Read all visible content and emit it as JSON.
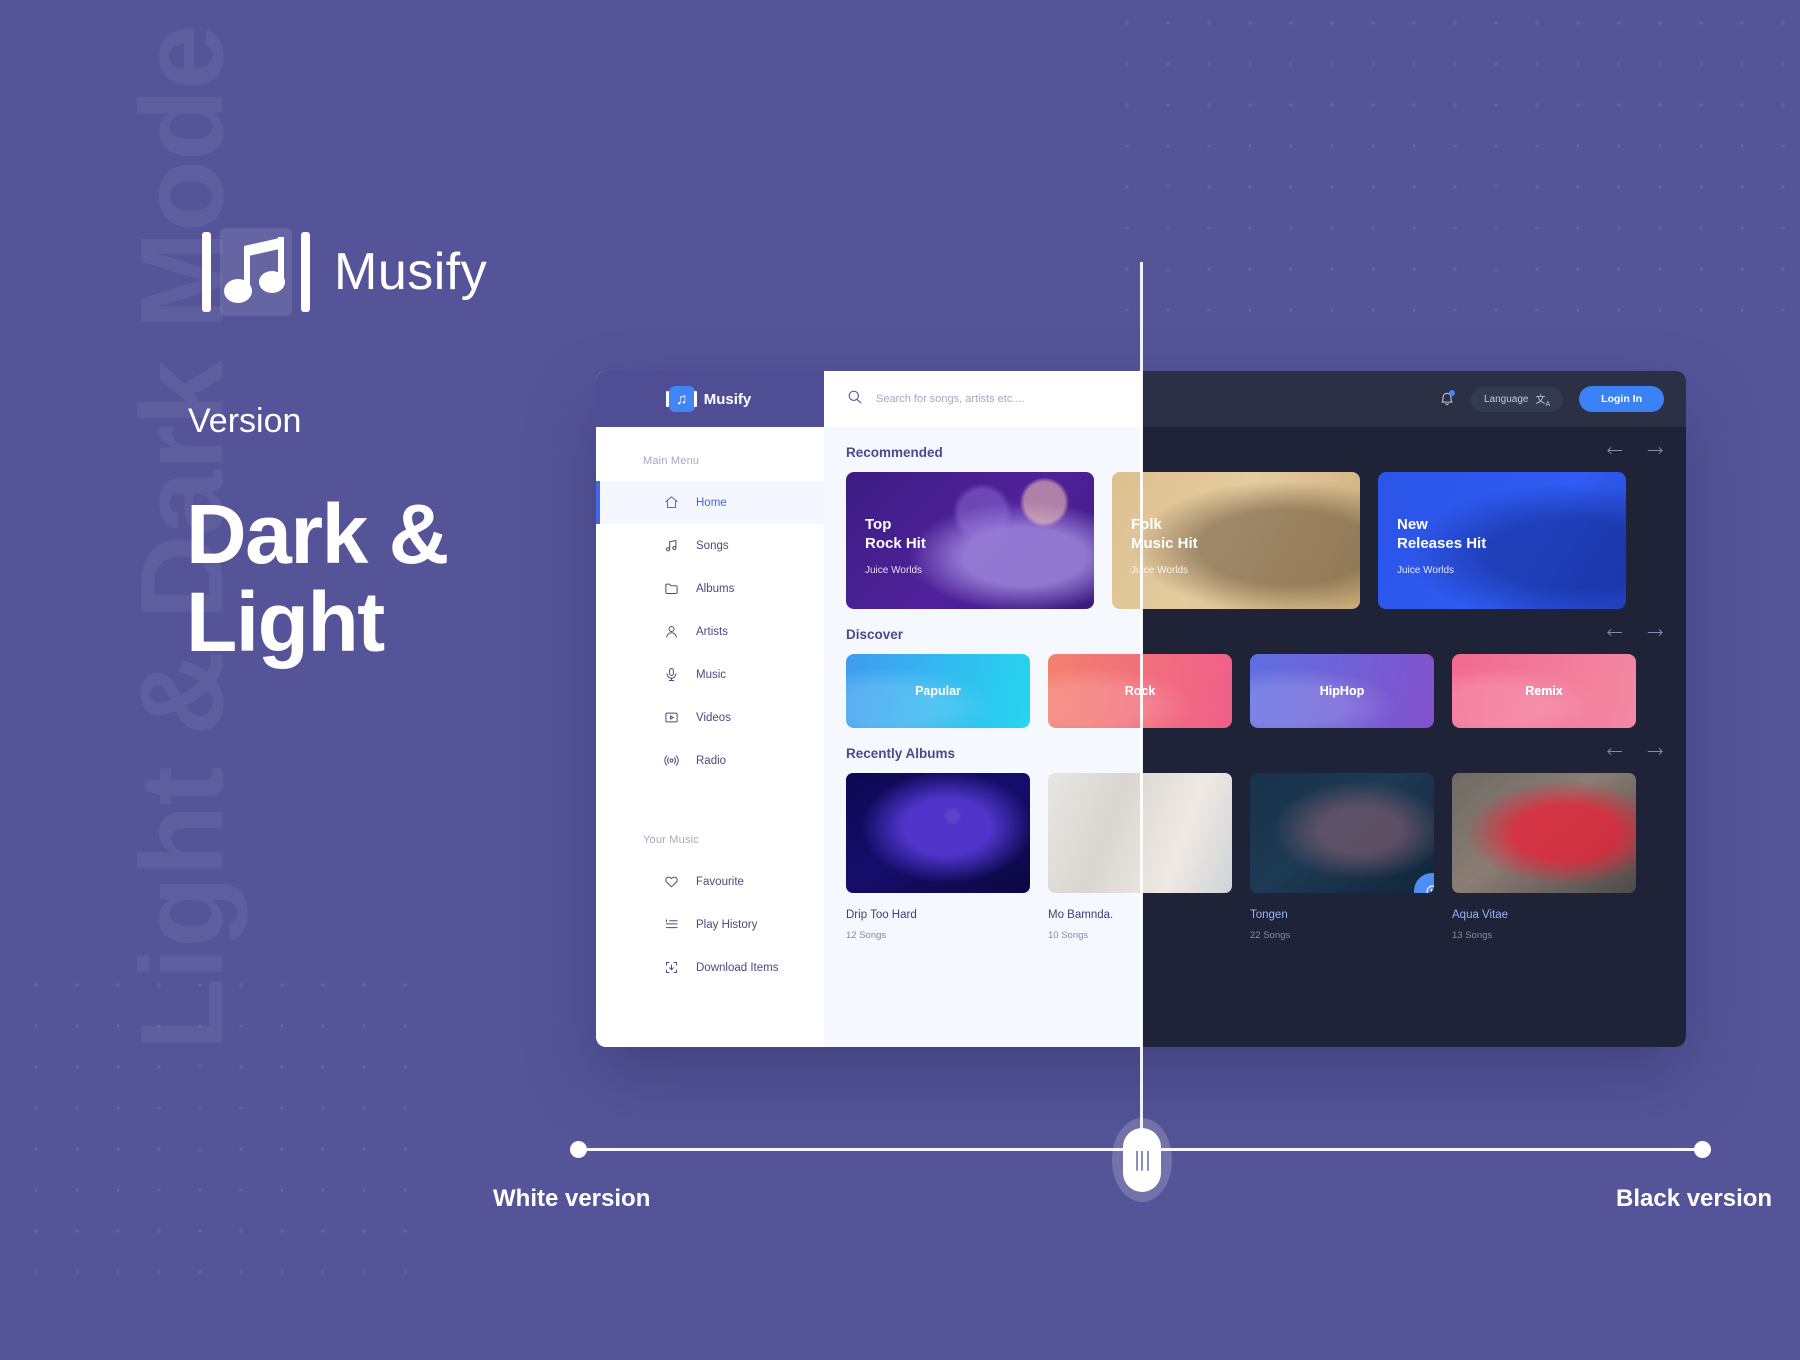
{
  "page": {
    "watermark": "Light & Dark Mode",
    "brand_name": "Musify",
    "kicker": "Version",
    "headline_line1": "Dark &",
    "headline_line2": "Light"
  },
  "slider": {
    "left_label": "White version",
    "right_label": "Black version",
    "handle_icon": "drag-handle-icon"
  },
  "colors": {
    "background": "#555499",
    "accent_blue": "#4285f4",
    "login_blue": "#3b82f6",
    "light_panel": "#f6f8ff",
    "dark_panel": "#1e2337",
    "dark_topbar": "#2b3045",
    "dark_sidebar": "#242a41",
    "active_light_bg": "#f4f7ff",
    "active_border": "#4267e8"
  },
  "app": {
    "logo_text": "Musify",
    "search": {
      "placeholder": "Search for songs, artists etc....",
      "value": "",
      "icon": "search-icon"
    },
    "topbar": {
      "notification_icon": "bell-icon",
      "has_notification_dot": true,
      "language_label": "Language",
      "language_icon": "translate-icon",
      "login_label": "Login In"
    },
    "sidebar": {
      "main_menu_label": "Main Menu",
      "your_music_label": "Your Music",
      "main_items": [
        {
          "label": "Home",
          "icon": "home-icon",
          "active": true
        },
        {
          "label": "Songs",
          "icon": "music-note-icon",
          "active": false
        },
        {
          "label": "Albums",
          "icon": "folder-icon",
          "active": false
        },
        {
          "label": "Artists",
          "icon": "user-icon",
          "active": false
        },
        {
          "label": "Music",
          "icon": "microphone-icon",
          "active": false
        },
        {
          "label": "Videos",
          "icon": "video-icon",
          "active": false
        },
        {
          "label": "Radio",
          "icon": "radio-icon",
          "active": false
        }
      ],
      "your_music_items": [
        {
          "label": "Favourite",
          "icon": "heart-icon"
        },
        {
          "label": "Play History",
          "icon": "list-icon"
        },
        {
          "label": "Download Items",
          "icon": "download-icon"
        }
      ]
    },
    "sections": [
      {
        "title": "Recommended",
        "prev_icon": "arrow-left-icon",
        "next_icon": "arrow-right-icon",
        "cards": [
          {
            "title_line1": "Top",
            "title_line2": "Rock Hit",
            "subtitle": "Juice Worlds"
          },
          {
            "title_line1": "Folk",
            "title_line2": "Music Hit",
            "subtitle": "Juice Worlds"
          },
          {
            "title_line1": "New",
            "title_line2": "Releases Hit",
            "subtitle": "Juice Worlds"
          }
        ]
      },
      {
        "title": "Discover",
        "prev_icon": "arrow-left-icon",
        "next_icon": "arrow-right-icon",
        "chips": [
          {
            "label": "Papular"
          },
          {
            "label": "Rock"
          },
          {
            "label": "HipHop"
          },
          {
            "label": "Remix"
          }
        ]
      },
      {
        "title": "Recently Albums",
        "prev_icon": "arrow-left-icon",
        "next_icon": "arrow-right-icon",
        "albums": [
          {
            "name": "Drip Too Hard",
            "count": "12 Songs",
            "has_play": false
          },
          {
            "name": "Mo Bamnda.",
            "count": "10 Songs",
            "has_play": false
          },
          {
            "name": "Tongen",
            "count": "22 Songs",
            "has_play": true
          },
          {
            "name": "Aqua Vitae",
            "count": "13 Songs",
            "has_play": false
          }
        ]
      }
    ]
  }
}
